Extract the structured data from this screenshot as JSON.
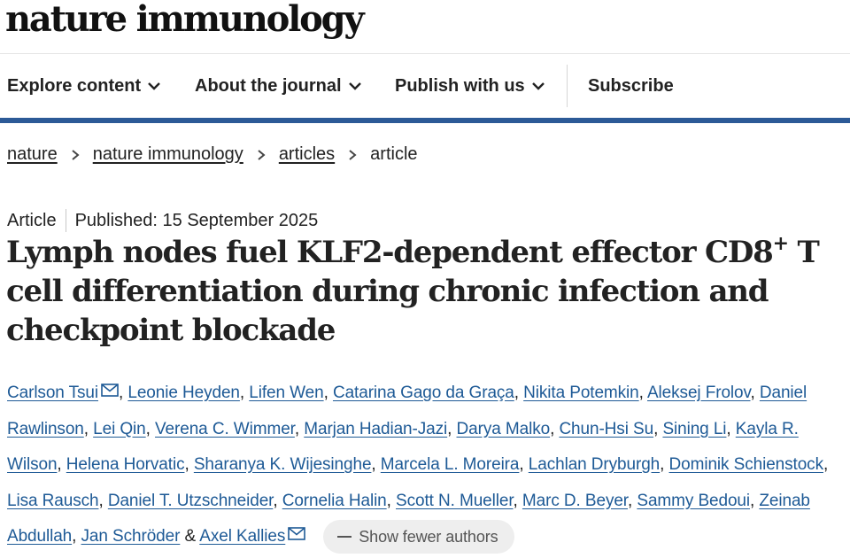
{
  "header": {
    "logo": "nature immunology"
  },
  "nav": {
    "items": [
      {
        "label": "Explore content"
      },
      {
        "label": "About the journal"
      },
      {
        "label": "Publish with us"
      }
    ],
    "subscribe": "Subscribe"
  },
  "breadcrumb": {
    "items": [
      "nature",
      "nature immunology",
      "articles"
    ],
    "current": "article"
  },
  "article": {
    "type": "Article",
    "published": "Published: 15 September 2025",
    "title_part1": "Lymph nodes fuel KLF2-dependent effector CD8",
    "title_sup": "+",
    "title_part2": " T cell differentiation during chronic infection and checkpoint blockade"
  },
  "authors": {
    "list": [
      "Carlson Tsui",
      "Leonie Heyden",
      "Lifen Wen",
      "Catarina Gago da Graça",
      "Nikita Potemkin",
      "Aleksej Frolov",
      "Daniel Rawlinson",
      "Lei Qin",
      "Verena C. Wimmer",
      "Marjan Hadian-Jazi",
      "Darya Malko",
      "Chun-Hsi Su",
      "Sining Li",
      "Kayla R. Wilson",
      "Helena Horvatic",
      "Sharanya K. Wijesinghe",
      "Marcela L. Moreira",
      "Lachlan Dryburgh",
      "Dominik Schienstock",
      "Lisa Rausch",
      "Daniel T. Utzschneider",
      "Cornelia Halin",
      "Scott N. Mueller",
      "Marc D. Beyer",
      "Sammy Bedoui",
      "Zeinab Abdullah",
      "Jan Schröder",
      "Axel Kallies"
    ],
    "comma": ",",
    "ampersand": "&",
    "show_fewer": "Show fewer authors"
  },
  "colors": {
    "accent": "#2c5a97",
    "link": "#1e5a96"
  },
  "icons": {
    "nav_chevron": "chevron-down-icon",
    "crumb_sep": "chevron-right-icon",
    "mail": "mail-icon"
  }
}
